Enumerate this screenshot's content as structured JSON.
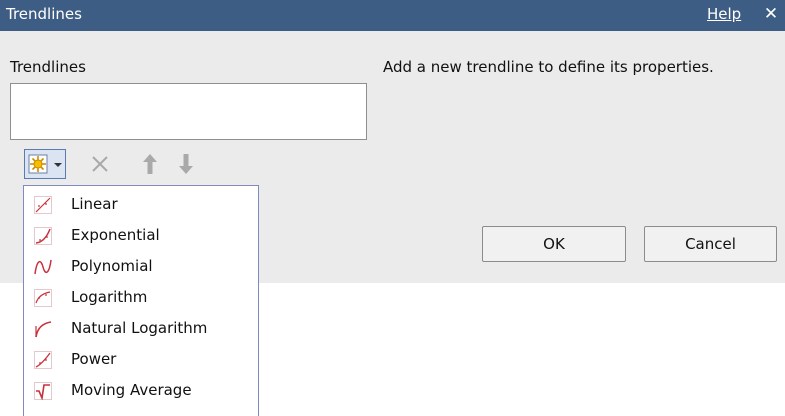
{
  "dialog": {
    "title": "Trendlines",
    "help_label": "Help",
    "close_symbol": "✕",
    "section_label": "Trendlines",
    "info_text": "Add a new trendline to define its properties.",
    "ok_label": "OK",
    "cancel_label": "Cancel"
  },
  "toolbar": {
    "add_icon": "sun-add-icon",
    "dropdown_icon": "chevron-down-icon",
    "delete_icon": "delete-x-icon",
    "move_up_icon": "arrow-up-icon",
    "move_down_icon": "arrow-down-icon"
  },
  "menu": {
    "items": [
      {
        "label": "Linear",
        "icon": "linear-trend-icon"
      },
      {
        "label": "Exponential",
        "icon": "exponential-trend-icon"
      },
      {
        "label": "Polynomial",
        "icon": "polynomial-trend-icon"
      },
      {
        "label": "Logarithm",
        "icon": "logarithm-trend-icon"
      },
      {
        "label": "Natural Logarithm",
        "icon": "natural-logarithm-trend-icon"
      },
      {
        "label": "Power",
        "icon": "power-trend-icon"
      },
      {
        "label": "Moving Average",
        "icon": "moving-average-trend-icon"
      }
    ]
  },
  "colors": {
    "titlebar": "#3e5d84",
    "dialog_bg": "#ebebeb",
    "menu_border": "#7d8cbd",
    "trend_icon_red": "#c8323c",
    "disabled_icon": "#a9a9a9"
  }
}
